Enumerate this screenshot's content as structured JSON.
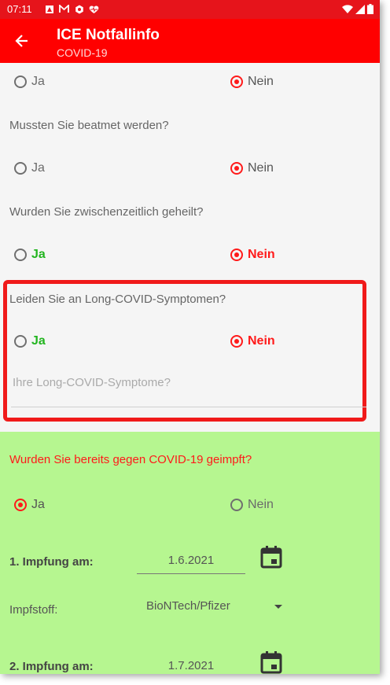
{
  "status_bar": {
    "time": "07:11",
    "icons": [
      "alarm-icon",
      "gmail-icon",
      "settings-gear-icon",
      "health-heart-icon"
    ],
    "right_icons": [
      "wifi-icon",
      "signal-icon",
      "battery-icon"
    ]
  },
  "app_bar": {
    "title": "ICE Notfallinfo",
    "subtitle": "COVID-19",
    "background": "#ff0000"
  },
  "questions": [
    {
      "id": "q0",
      "label": "",
      "yes": "Ja",
      "no": "Nein",
      "selected": "no",
      "style": "plain"
    },
    {
      "id": "q1",
      "label": "Mussten Sie beatmet werden?",
      "yes": "Ja",
      "no": "Nein",
      "selected": "no",
      "style": "plain"
    },
    {
      "id": "q2",
      "label": "Wurden Sie zwischenzeitlich geheilt?",
      "yes": "Ja",
      "no": "Nein",
      "selected": "no",
      "style": "colored"
    },
    {
      "id": "q3",
      "label": "Leiden Sie an Long-COVID-Symptomen?",
      "yes": "Ja",
      "no": "Nein",
      "selected": "no",
      "style": "colored"
    }
  ],
  "long_covid_input": {
    "placeholder": "Ihre Long-COVID-Symptome?",
    "value": ""
  },
  "vaccination": {
    "question": "Wurden Sie bereits gegen COVID-19 geimpft?",
    "yes": "Ja",
    "no": "Nein",
    "selected": "yes",
    "first_dose_label": "1. Impfung am:",
    "first_dose_date": "1.6.2021",
    "vaccine_label": "Impfstoff:",
    "vaccine_value": "BioNTech/Pfizer",
    "second_dose_label": "2. Impfung am:",
    "second_dose_date": "1.7.2021",
    "background": "#b6f690"
  },
  "colors": {
    "accent": "#ff1a1a",
    "yes_green": "#22b51f",
    "highlight_border": "#f01a1a"
  }
}
